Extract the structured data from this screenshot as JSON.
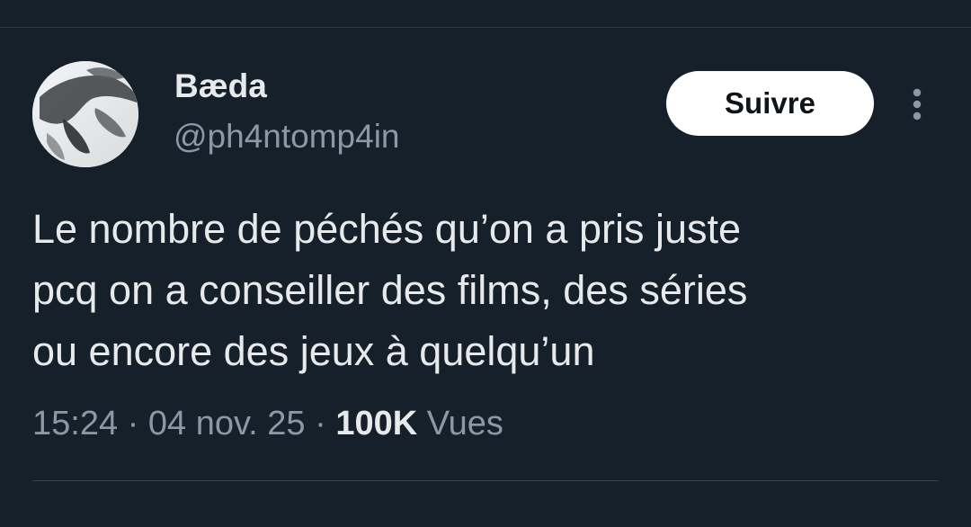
{
  "author": {
    "display_name": "Bæda",
    "handle": "@ph4ntomp4in",
    "avatar_icon": "profile-photo"
  },
  "actions": {
    "follow_label": "Suivre",
    "more_icon": "more-vertical-icon"
  },
  "tweet": {
    "lines": [
      "Le nombre de péchés qu’on a pris juste",
      "pcq on a conseiller des films, des séries",
      "ou encore des jeux à quelqu’un"
    ]
  },
  "meta": {
    "time": "15:24",
    "separator": "·",
    "date": "04 nov. 25",
    "views_count": "100K",
    "views_label": "Vues"
  },
  "colors": {
    "background": "#15202b",
    "text_primary": "#e7e9ea",
    "text_secondary": "#8b98a5",
    "button_bg": "#ffffff",
    "button_text": "#0f1419"
  }
}
